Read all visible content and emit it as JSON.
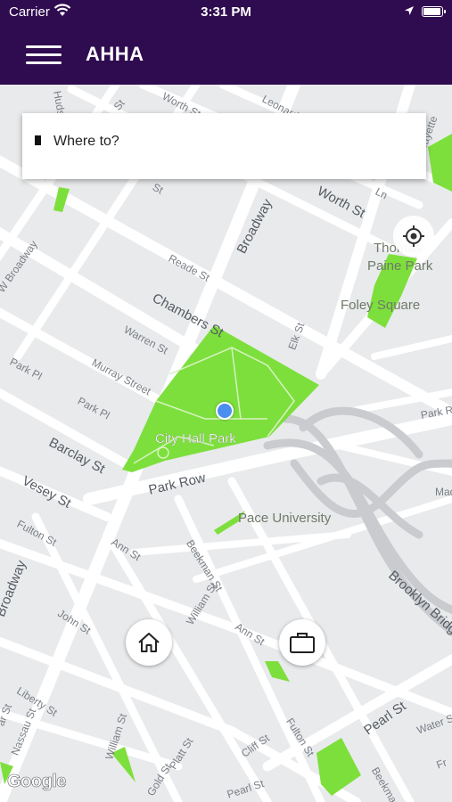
{
  "status_bar": {
    "carrier": "Carrier",
    "time": "3:31 PM",
    "battery_level": 0.95
  },
  "app_bar": {
    "title": "AHHA"
  },
  "search": {
    "placeholder": "Where to?"
  },
  "map": {
    "streets": {
      "hudson": "Hudson",
      "worth_st_top": "Worth St",
      "leonard_st": "Leonard St",
      "lafayette": "Lafayette",
      "thomas_st": "St",
      "st_short": "St",
      "worth_st": "Worth St",
      "ln": "Ln",
      "broadway_north": "Broadway",
      "w_broadway": "W Broadway",
      "reade_st": "Reade St",
      "chambers_st": "Chambers St",
      "warren_st": "Warren St",
      "elk_st": "Elk St",
      "murray_street": "Murray Street",
      "park_pl_left": "Park Pl",
      "park_pl": "Park Pl",
      "barclay_st": "Barclay St",
      "park_row_right": "Park Row",
      "vesey_st": "Vesey St",
      "park_row": "Park Row",
      "mad": "Mad",
      "fulton_st_left": "Fulton St",
      "ann_st_left": "Ann St",
      "beekman_st": "Beekman St",
      "brooklyn_bridge": "Brooklyn Bridge",
      "broadway_south": "Broadway",
      "john_st": "John St",
      "william_st": "William St",
      "ann_st": "Ann St",
      "liberty_st": "Liberty St",
      "nassau_st": "Nassau St",
      "ar_st": "ar St",
      "pearl_st": "Pearl St",
      "water_st": "Water St",
      "fr": "Fr",
      "cliff_st": "Cliff St",
      "fulton_st": "Fulton St",
      "platt_st": "Platt St",
      "gold_st": "Gold St",
      "william_st_bottom": "William St",
      "pearl_st_bottom": "Pearl St",
      "beekman_bottom": "Beekman"
    },
    "places": {
      "thomas_paine_park_1": "Thomas",
      "thomas_paine_park_2": "Paine Park",
      "foley_square": "Foley Square",
      "city_hall_park": "City Hall Park",
      "pace_university": "Pace University"
    },
    "attribution": "Google"
  },
  "shortcuts": [
    {
      "name": "home",
      "icon": "home-icon"
    },
    {
      "name": "work",
      "icon": "briefcase-icon"
    }
  ],
  "colors": {
    "brand": "#2f0b4f",
    "park": "#7ddf3c",
    "user_location": "#4a8ef0"
  }
}
